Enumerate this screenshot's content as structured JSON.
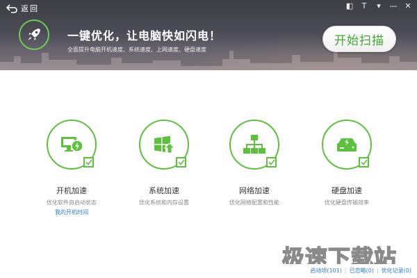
{
  "header": {
    "back_label": "返回",
    "headline": "一键优化，让电脑快如闪电！",
    "subline": "全面提升电脑开机速度、系统速度、上网速度、硬盘速度",
    "scan_button": "开始扫描",
    "window_controls": [
      {
        "name": "skin-icon",
        "glyph": "◧"
      },
      {
        "name": "shirt-icon",
        "glyph": "T"
      },
      {
        "name": "menu-dropdown-icon",
        "glyph": "▾"
      },
      {
        "name": "minimize-icon",
        "glyph": "—"
      },
      {
        "name": "close-icon",
        "glyph": "✕"
      }
    ]
  },
  "features": [
    {
      "id": "boot",
      "title": "开机加速",
      "desc": "优化软件自启动状态",
      "link": "我的开机时间",
      "icon": "monitor-lightning-icon",
      "checked": true
    },
    {
      "id": "system",
      "title": "系统加速",
      "desc": "优化系统和内存设置",
      "link": "",
      "icon": "windows-upgrade-icon",
      "checked": true
    },
    {
      "id": "network",
      "title": "网络加速",
      "desc": "优化网络配置和性能",
      "link": "",
      "icon": "network-topology-icon",
      "checked": true
    },
    {
      "id": "disk",
      "title": "硬盘加速",
      "desc": "优化硬盘传输效率",
      "link": "",
      "icon": "hard-drive-icon",
      "checked": true
    }
  ],
  "footer": {
    "startup_items": "启动项(101)",
    "ignored": "已忽略(0)",
    "history": "优化记录(0)"
  },
  "watermark": "极速下载站",
  "colors": {
    "accent_green": "#5cc23c",
    "scan_text_green": "#3faa2f",
    "link_blue": "#2a7bd6"
  }
}
